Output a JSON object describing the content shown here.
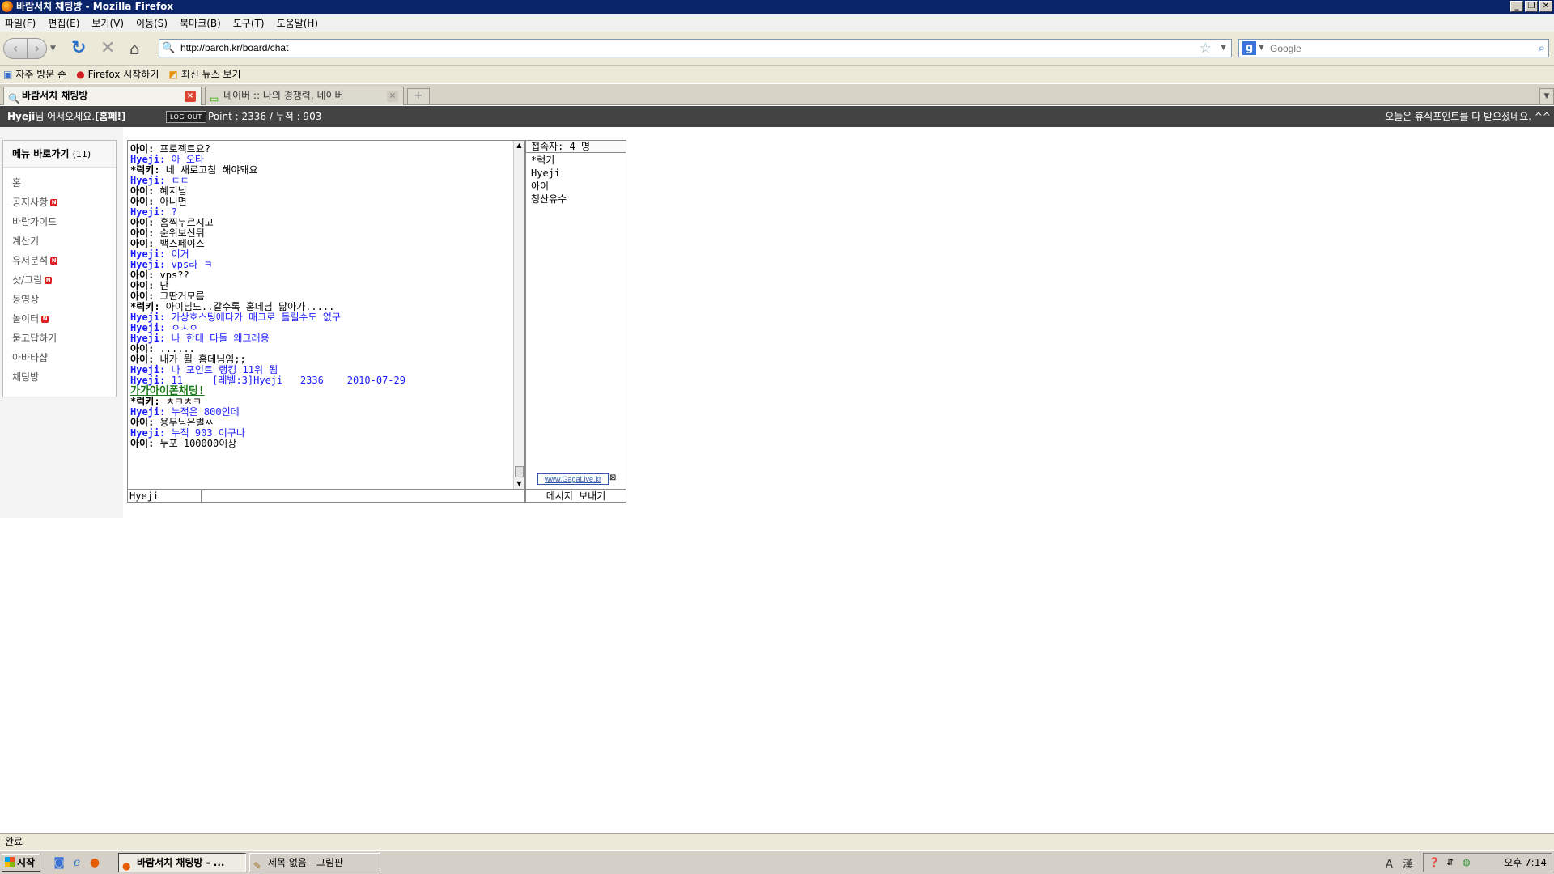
{
  "window": {
    "title": "바람서치 채팅방 - Mozilla Firefox"
  },
  "menubar": [
    "파일(F)",
    "편집(E)",
    "보기(V)",
    "이동(S)",
    "북마크(B)",
    "도구(T)",
    "도움말(H)"
  ],
  "nav": {
    "url": "http://barch.kr/board/chat",
    "search_placeholder": "Google"
  },
  "bookmarks": [
    {
      "label": "자주 방문 숀",
      "icon": "bookmark-folder-icon"
    },
    {
      "label": "Firefox 시작하기",
      "icon": "firefox-icon"
    },
    {
      "label": "최신 뉴스 보기",
      "icon": "rss-icon"
    }
  ],
  "tabs": [
    {
      "label": "바람서치 채팅방",
      "active": true
    },
    {
      "label": "네이버 :: 나의 경쟁력, 네이버",
      "active": false
    }
  ],
  "site_header": {
    "user": "Hyeji",
    "greeting_suffix": "님 어서오세요.",
    "homepage": "[홈페!]",
    "logout": "LOG OUT",
    "points": "Point : 2336 / 누적 : 903",
    "right_message": "오늘은 휴식포인트를 다 받으셨네요. ^^"
  },
  "left_menu": {
    "title": "메뉴 바로가기",
    "count": "(11)",
    "items": [
      {
        "label": "홈",
        "new": false
      },
      {
        "label": "공지사항",
        "new": true
      },
      {
        "label": "바람가이드",
        "new": false
      },
      {
        "label": "계산기",
        "new": false
      },
      {
        "label": "유저분석",
        "new": true
      },
      {
        "label": "샷/그림",
        "new": true
      },
      {
        "label": "동영상",
        "new": false
      },
      {
        "label": "놀이터",
        "new": true
      },
      {
        "label": "묻고답하기",
        "new": false
      },
      {
        "label": "아바타샵",
        "new": false
      },
      {
        "label": "채팅방",
        "new": false
      }
    ],
    "new_badge": "N"
  },
  "chat": {
    "messages": [
      {
        "nick": "아이",
        "text": "프로젝트요?",
        "type": "ahi"
      },
      {
        "nick": "Hyeji",
        "text": "아 오타",
        "type": "hyeji"
      },
      {
        "nick": "*럭키",
        "text": "네 새로고침 해야돼요",
        "type": "luck"
      },
      {
        "nick": "Hyeji",
        "text": "ㄷㄷ",
        "type": "hyeji"
      },
      {
        "nick": "아이",
        "text": "혜지님",
        "type": "ahi"
      },
      {
        "nick": "아이",
        "text": "아니면",
        "type": "ahi"
      },
      {
        "nick": "Hyeji",
        "text": "?",
        "type": "hyeji"
      },
      {
        "nick": "아이",
        "text": "홈찍누르시고",
        "type": "ahi"
      },
      {
        "nick": "아이",
        "text": "순위보신뒤",
        "type": "ahi"
      },
      {
        "nick": "아이",
        "text": "백스페이스",
        "type": "ahi"
      },
      {
        "nick": "Hyeji",
        "text": "이거",
        "type": "hyeji"
      },
      {
        "nick": "Hyeji",
        "text": "vps라 ㅋ",
        "type": "hyeji"
      },
      {
        "nick": "아이",
        "text": "vps??",
        "type": "ahi"
      },
      {
        "nick": "아이",
        "text": "난",
        "type": "ahi"
      },
      {
        "nick": "아이",
        "text": "그딴거모름",
        "type": "ahi"
      },
      {
        "nick": "*럭키",
        "text": "아이님도..갈수록 홈데님 닮아가.....",
        "type": "luck"
      },
      {
        "nick": "Hyeji",
        "text": "가상호스팅에다가 매크로 돌릴수도 없구",
        "type": "hyeji"
      },
      {
        "nick": "Hyeji",
        "text": "ㅇㅅㅇ",
        "type": "hyeji"
      },
      {
        "nick": "Hyeji",
        "text": "나 한데 다들 왜그래용",
        "type": "hyeji"
      },
      {
        "nick": "아이",
        "text": "......",
        "type": "ahi"
      },
      {
        "nick": "아이",
        "text": "내가 뭘 홈데님임;;",
        "type": "ahi"
      },
      {
        "nick": "Hyeji",
        "text": "나 포인트 랭킹 11위 됨",
        "type": "hyeji"
      },
      {
        "nick": "Hyeji",
        "text": "11     [레벨:3]Hyeji   2336    2010-07-29",
        "type": "hyeji"
      },
      {
        "nick": "",
        "text": "가가아이폰채팅!",
        "type": "special"
      },
      {
        "nick": "*럭키",
        "text": "ㅊㅋㅊㅋ",
        "type": "luck"
      },
      {
        "nick": "Hyeji",
        "text": "누적은 800인데",
        "type": "hyeji"
      },
      {
        "nick": "아이",
        "text": "용무님은벌ㅆ",
        "type": "ahi"
      },
      {
        "nick": "Hyeji",
        "text": "누적 903 이구나",
        "type": "hyeji"
      },
      {
        "nick": "아이",
        "text": "누포 100000이상",
        "type": "ahi"
      }
    ],
    "users_header": "접속자: 4 명",
    "users": [
      "*럭키",
      "Hyeji",
      "아이",
      "청산유수"
    ],
    "gaga_link": "www.GagaLive.kr",
    "nick_value": "Hyeji",
    "send_label": "메시지 보내기"
  },
  "status": "완료",
  "taskbar": {
    "start": "시작",
    "items": [
      {
        "label": "바람서치 채팅방 - ...",
        "active": true
      },
      {
        "label": "제목 없음 - 그림판",
        "active": false
      }
    ],
    "ime": "A 漢",
    "clock": "오후 7:14"
  }
}
